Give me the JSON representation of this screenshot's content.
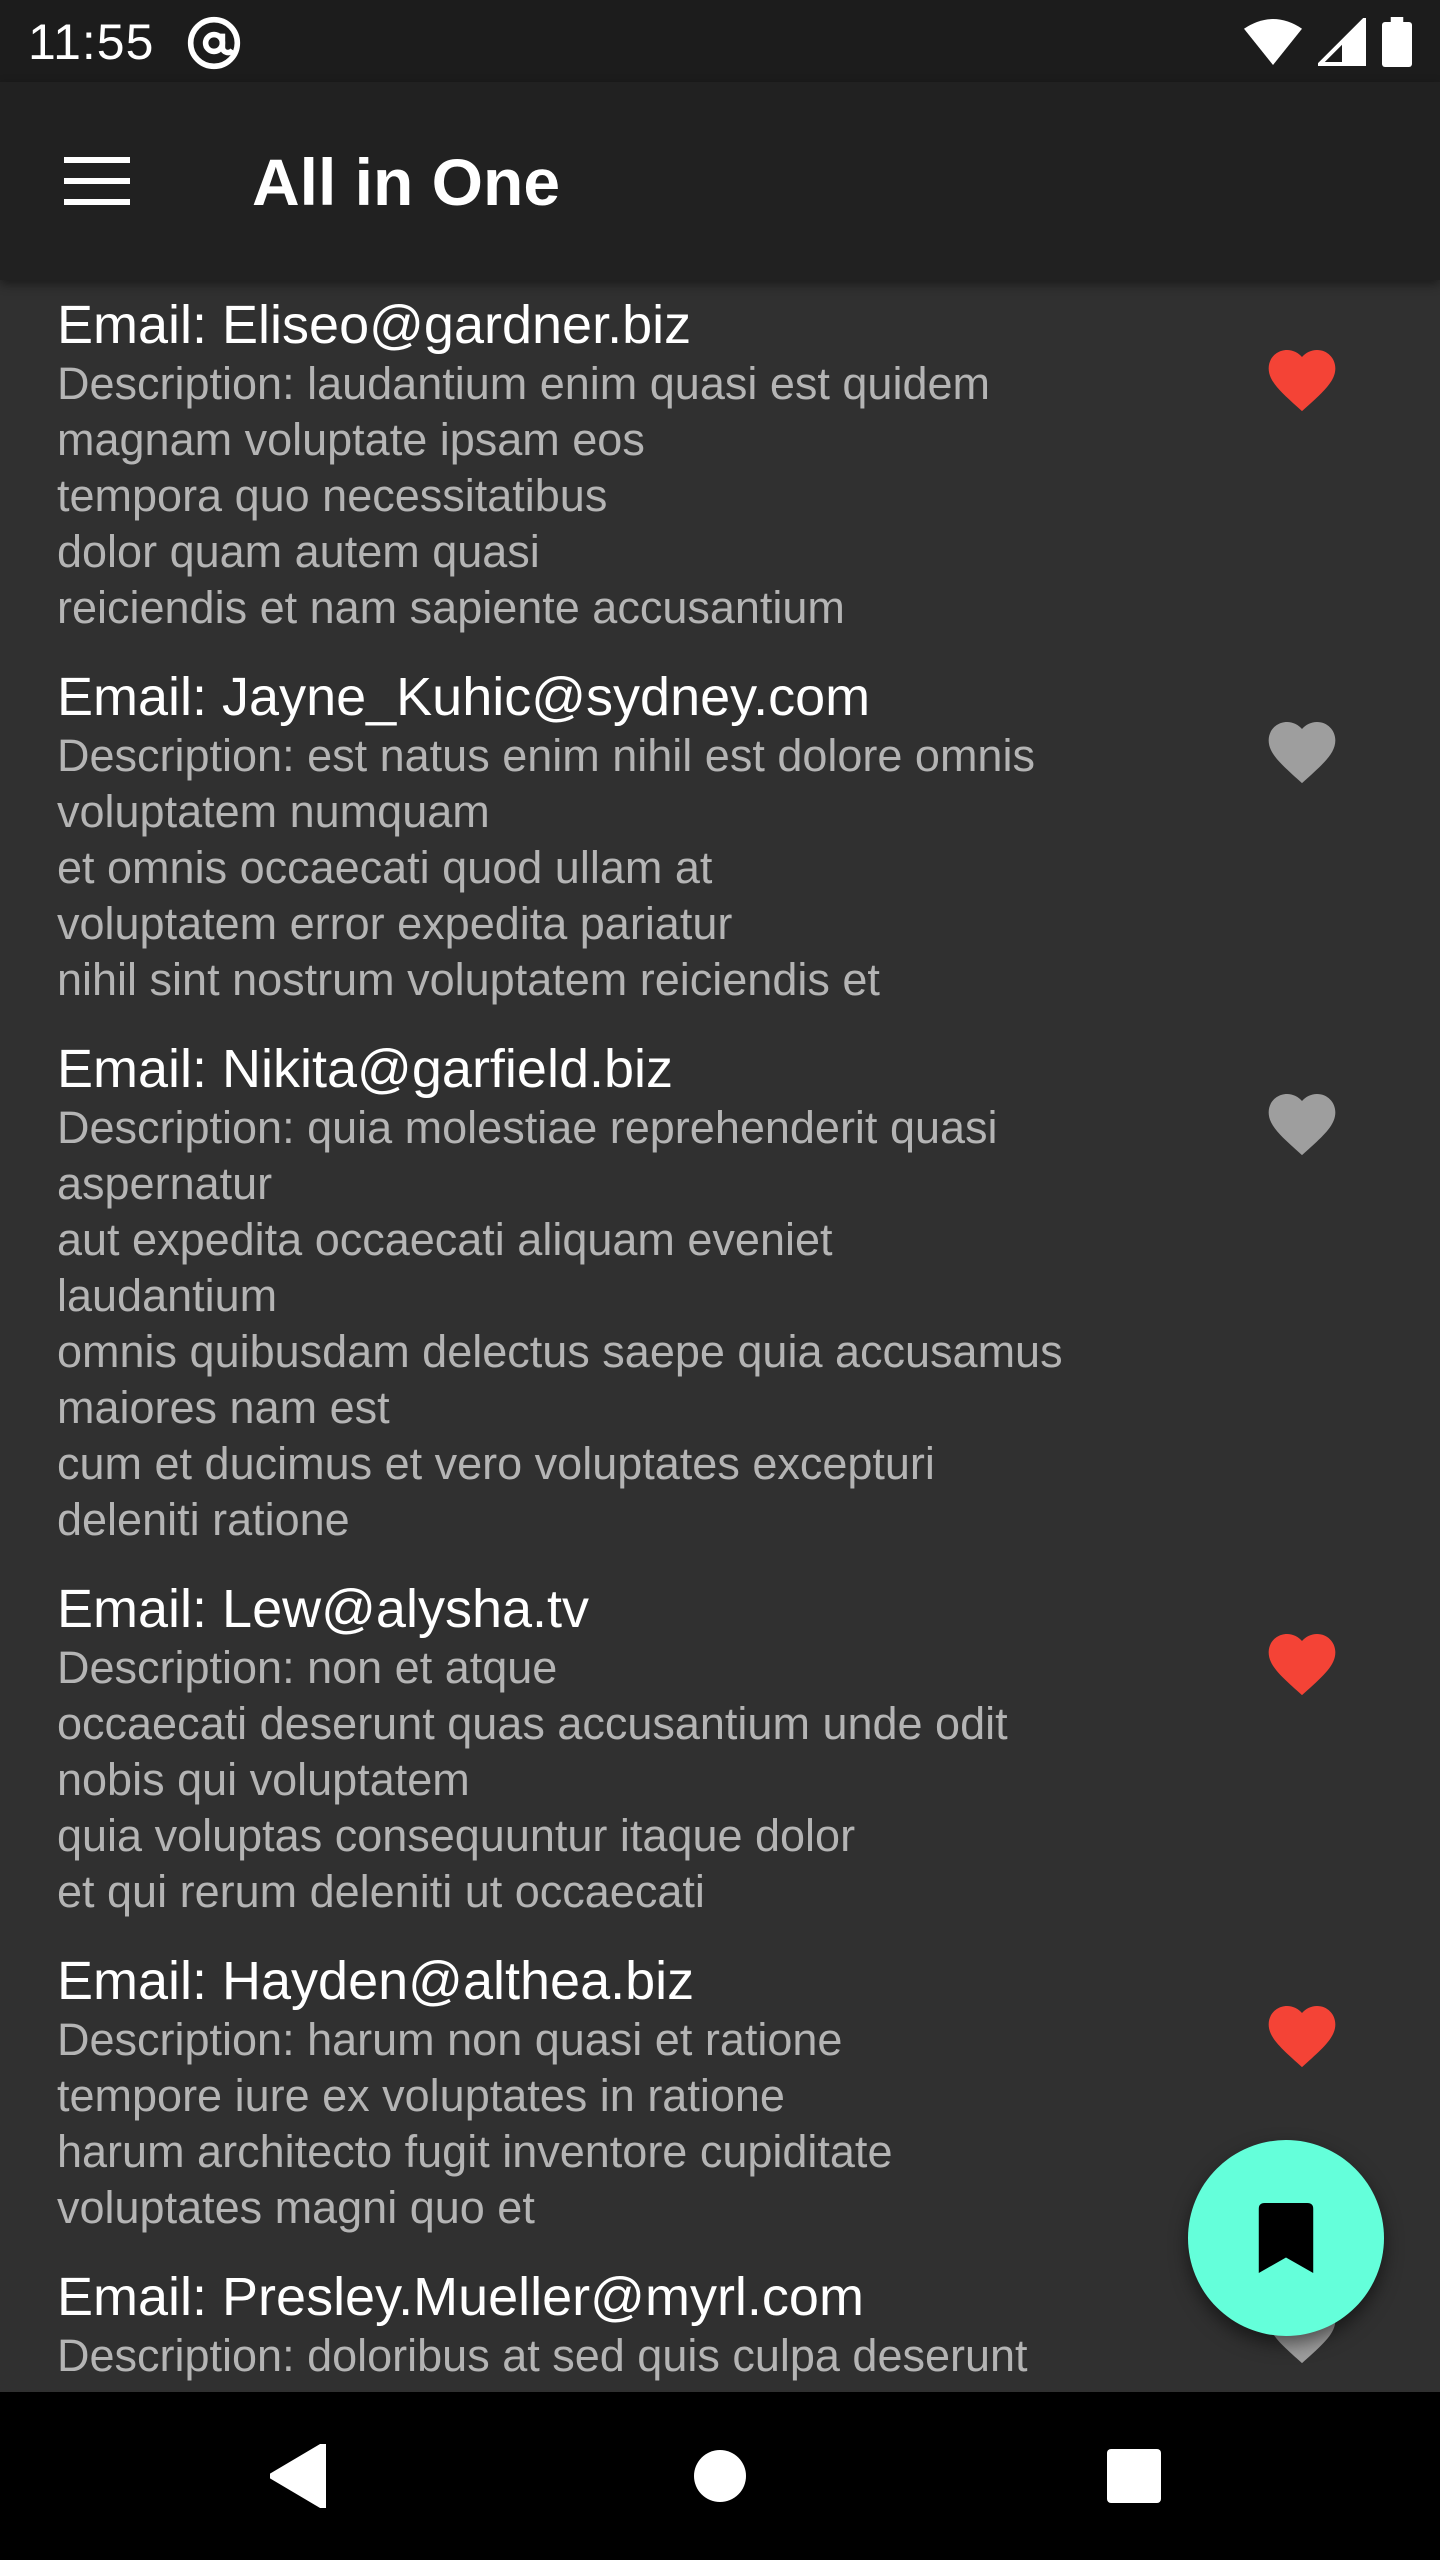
{
  "status_bar": {
    "time": "11:55",
    "icons": [
      "at-sign-icon",
      "wifi-icon",
      "signal-icon",
      "battery-icon"
    ]
  },
  "app_bar": {
    "menu_icon": "hamburger-menu-icon",
    "title": "All in One"
  },
  "colors": {
    "favorite_on": "#f44336",
    "favorite_off": "#9e9e9e",
    "fab_background": "#64ffda",
    "app_bar": "#212121",
    "list_background": "#303030"
  },
  "items": [
    {
      "email": "Email: Eliseo@gardner.biz",
      "description": [
        "Description: laudantium enim quasi est quidem",
        "magnam voluptate ipsam eos",
        "tempora quo necessitatibus",
        "dolor quam autem quasi",
        "reiciendis et nam sapiente accusantium"
      ],
      "favorite": true
    },
    {
      "email": "Email: Jayne_Kuhic@sydney.com",
      "description": [
        "Description: est natus enim nihil est dolore omnis",
        "voluptatem numquam",
        "et omnis occaecati quod ullam at",
        "voluptatem error expedita pariatur",
        "nihil sint nostrum voluptatem reiciendis et"
      ],
      "favorite": false
    },
    {
      "email": "Email: Nikita@garfield.biz",
      "description": [
        "Description: quia molestiae reprehenderit quasi",
        "aspernatur",
        "aut expedita occaecati aliquam eveniet",
        "laudantium",
        "omnis quibusdam delectus saepe quia accusamus",
        "maiores nam est",
        "cum et ducimus et vero voluptates excepturi",
        "deleniti ratione"
      ],
      "favorite": false
    },
    {
      "email": "Email: Lew@alysha.tv",
      "description": [
        "Description: non et atque",
        "occaecati deserunt quas accusantium unde odit",
        "nobis qui voluptatem",
        "quia voluptas consequuntur itaque dolor",
        "et qui rerum deleniti ut occaecati"
      ],
      "favorite": true
    },
    {
      "email": "Email: Hayden@althea.biz",
      "description": [
        "Description: harum non quasi et ratione",
        "tempore iure ex voluptates in ratione",
        "harum architecto fugit inventore cupiditate",
        "voluptates magni quo et"
      ],
      "favorite": true
    },
    {
      "email": "Email: Presley.Mueller@myrl.com",
      "description": [
        "Description: doloribus at sed quis culpa deserunt"
      ],
      "favorite": false
    }
  ],
  "fab": {
    "icon": "bookmark-icon"
  },
  "nav_bar": {
    "icons": [
      "back-icon",
      "home-icon",
      "recents-icon"
    ]
  }
}
